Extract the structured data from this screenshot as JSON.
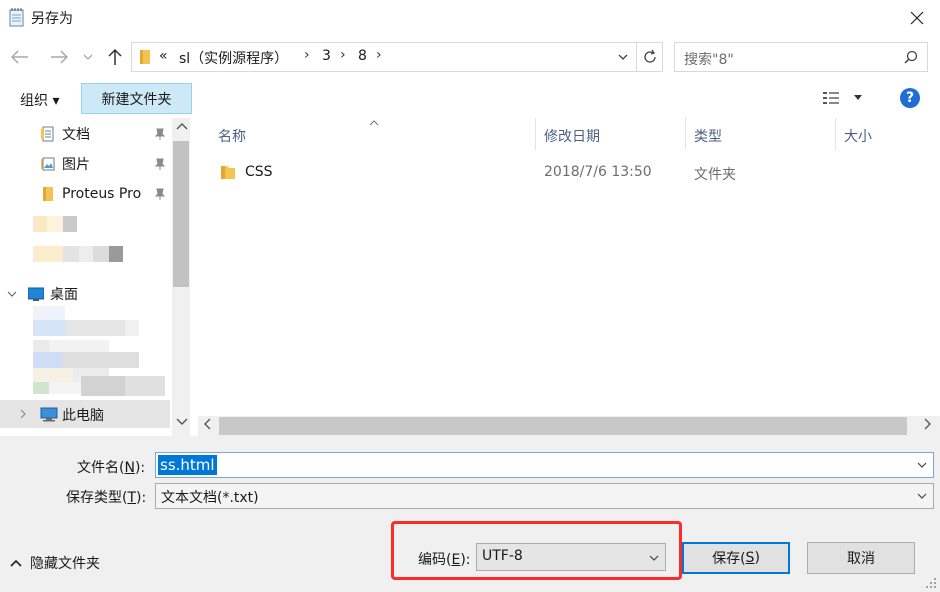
{
  "window": {
    "title": "另存为"
  },
  "address": {
    "overflow": "«",
    "segments": [
      "sl（实例源程序）",
      "3",
      "8"
    ]
  },
  "search": {
    "placeholder": "搜索\"8\""
  },
  "toolbar": {
    "organize": "组织 ▾",
    "new_folder": "新建文件夹"
  },
  "sidebar": {
    "items": [
      {
        "label": "文档",
        "icon": "document-icon",
        "pinned": true
      },
      {
        "label": "图片",
        "icon": "picture-icon",
        "pinned": true
      },
      {
        "label": "Proteus Pro",
        "icon": "folder-icon",
        "pinned": true
      },
      {
        "label": "桌面",
        "icon": "desktop-icon"
      },
      {
        "label": "此电脑",
        "icon": "computer-icon"
      }
    ]
  },
  "columns": {
    "name": "名称",
    "modified": "修改日期",
    "type": "类型",
    "size": "大小"
  },
  "files": [
    {
      "name": "CSS",
      "modified": "2018/7/6 13:50",
      "type": "文件夹",
      "icon": "folder-icon"
    }
  ],
  "form": {
    "filename_label_pre": "文件名(",
    "filename_key": "N",
    "filename_label_post": "):",
    "filename_value": "ss.html",
    "filetype_label_pre": "保存类型(",
    "filetype_key": "T",
    "filetype_label_post": "):",
    "filetype_value": "文本文档(*.txt)",
    "encoding_label_pre": "编码(",
    "encoding_key": "E",
    "encoding_label_post": "):",
    "encoding_value": "UTF-8"
  },
  "footer": {
    "hide_folders": "隐藏文件夹",
    "save_pre": "保存(",
    "save_key": "S",
    "save_post": ")",
    "cancel": "取消"
  },
  "colors": {
    "accent": "#0078d7",
    "highlight_box": "#ff2a2a",
    "selection_bg": "#cde8f7"
  }
}
